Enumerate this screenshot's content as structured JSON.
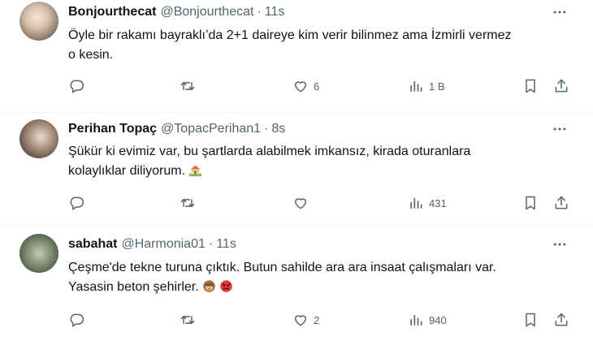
{
  "tweets": [
    {
      "name": "Bonjourthecat",
      "handle": "@Bonjourthecat",
      "time": "11s",
      "text_lines": [
        "Öyle bir rakamı bayraklı’da 2+1 daireye kim verir bilinmez ama İzmirli vermez",
        "o kesin."
      ],
      "replies": "",
      "retweets": "",
      "likes": "6",
      "views": "1 B",
      "emojis": []
    },
    {
      "name": "Perihan Topaç",
      "handle": "@TopacPerihan1",
      "time": "8s",
      "text_lines": [
        "Şükür ki evimiz var, bu şartlarda alabilmek imkansız, kirada oturanlara",
        "kolaylıklar diliyorum."
      ],
      "replies": "",
      "retweets": "",
      "likes": "",
      "views": "431",
      "emojis": [
        "house-with-garden"
      ]
    },
    {
      "name": "sabahat",
      "handle": "@Harmonia01",
      "time": "11s",
      "text_lines": [
        "Çeşme'de tekne turuna çıktık. Butun sahilde ara ara insaat çalışmaları var.",
        "Yasasin beton şehirler."
      ],
      "replies": "",
      "retweets": "",
      "likes": "2",
      "views": "940",
      "emojis": [
        "see-no-evil-monkey",
        "angry-face"
      ]
    }
  ],
  "colors": {
    "text": "#0f1419",
    "muted": "#536471",
    "divider": "#eff3f4"
  },
  "icons": [
    "reply-icon",
    "retweet-icon",
    "like-icon",
    "views-icon",
    "bookmark-icon",
    "share-icon",
    "more-icon"
  ]
}
